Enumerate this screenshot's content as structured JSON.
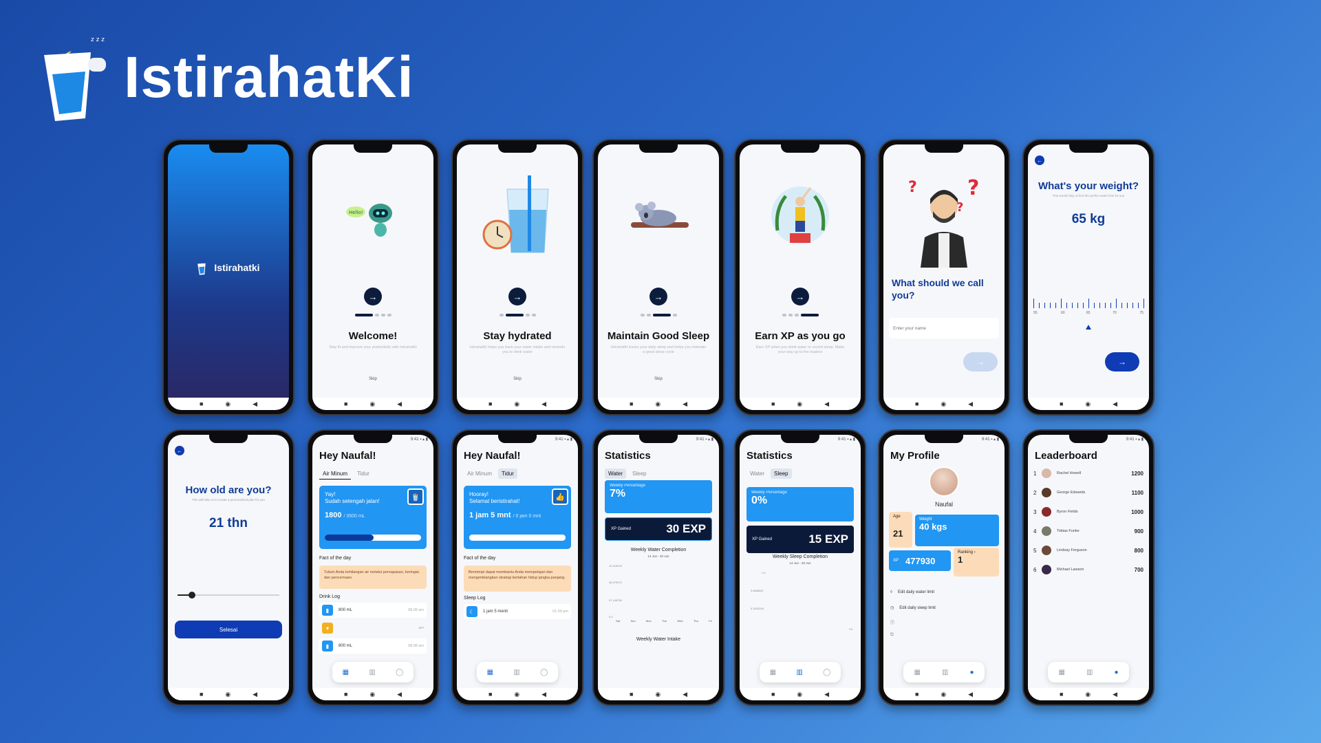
{
  "brand": {
    "name": "IstirahatKi",
    "sleep_glyph": "z z z"
  },
  "colors": {
    "primary": "#0f3cb4",
    "accent_blue": "#2196f3",
    "dark_navy": "#0c1a3a",
    "fact_bg": "#fcdcb8"
  },
  "splash": {
    "name": "Istirahatki"
  },
  "onboarding": [
    {
      "title": "Welcome!",
      "sub": "Stay fit and improve your productivity with IstirahatKi",
      "illus_icon": "robot-icon",
      "bubble": "Hello!",
      "skip": "Skip"
    },
    {
      "title": "Stay hydrated",
      "sub": "IstirahatKi helps you track your water intake and reminds you to drink water",
      "illus_icon": "water-glass-icon",
      "skip": "Skip"
    },
    {
      "title": "Maintain Good Sleep",
      "sub": "IstirahatKi tracks your daily sleep and helps you maintain a good sleep cycle",
      "illus_icon": "sleeping-koala-icon",
      "skip": "Skip"
    },
    {
      "title": "Earn XP as you go",
      "sub": "Earn XP when you drink water or record sleep. Make your way up to the leaders",
      "illus_icon": "trophy-person-icon"
    }
  ],
  "name_screen": {
    "title": "What should we call you?",
    "placeholder": "Enter your name"
  },
  "weight_screen": {
    "title": "What's your weight?",
    "sub": "This would help us find the perfect water limit for you",
    "value": "65 kg",
    "ticks": [
      "55",
      "60",
      "65",
      "70",
      "75"
    ]
  },
  "age_screen": {
    "title": "How old are you?",
    "sub": "This will help us to create a personalized plan for you",
    "value": "21 thn",
    "button": "Selesai"
  },
  "home_water": {
    "greeting": "Hey Naufal!",
    "tabs": [
      "Air Minum",
      "Tidur"
    ],
    "hero_l1": "Yay!",
    "hero_l2": "Sudah setengah jalan!",
    "hero_value": "1800",
    "hero_total": "/ 3500 mL",
    "progress": 0.51,
    "fact_label": "Fact of the day",
    "fact": "Tubuh Anda kehilangan air melalui pernapasan, keringat, dan pencernaan.",
    "log_label": "Drink Log",
    "logs": [
      {
        "amount": "800 mL",
        "time": "08.08 am"
      },
      {
        "amount": "",
        "time": "am"
      },
      {
        "amount": "800 mL",
        "time": "08.08 am"
      }
    ]
  },
  "home_sleep": {
    "greeting": "Hey Naufal!",
    "tabs": [
      "Air Minum",
      "Tidur"
    ],
    "hero_l1": "Hooray!",
    "hero_l2": "Selamat beristirahat!",
    "hero_value": "1 jam 5 mnt",
    "hero_total": "/ 0 jam 0 mnt",
    "progress": 1.0,
    "fact_label": "Fact of the day",
    "fact": "Bermimpi dapat membantu Anda mempelajari dan mengembangkan strategi bertahan hidup jangka panjang.",
    "log_label": "Sleep Log",
    "log": {
      "amount": "1 jam 5 menit",
      "time": "01.59 pm"
    }
  },
  "stats_water": {
    "title": "Statistics",
    "tabs": [
      "Water",
      "Sleep"
    ],
    "pct_label": "Weekly Percentage",
    "pct": "7%",
    "xp_label": "XP Gained",
    "xp": "30 EXP",
    "chart_title": "Weekly Water Completion",
    "chart_range": "14 Jun - 20 Jun",
    "y_ticks": [
      "10.419576",
      "36.075372",
      "57.148755",
      "0.0"
    ],
    "days": [
      "Sat",
      "Sun",
      "Mon",
      "Tue",
      "Wed",
      "Thu",
      "Fri"
    ],
    "chart2_title": "Weekly Water Intake"
  },
  "stats_sleep": {
    "title": "Statistics",
    "tabs": [
      "Water",
      "Sleep"
    ],
    "pct_label": "Weekly Percentage",
    "pct": "0%",
    "xp_label": "XP Gained",
    "xp": "15 EXP",
    "chart_title": "Weekly Sleep Completion",
    "chart_range": "14 Jun - 20 Jun",
    "y_ticks": [
      "1.0",
      "0.6666667",
      "0.3333333"
    ],
    "fri": "Fri"
  },
  "profile": {
    "title": "My Profile",
    "name": "Naufal",
    "age_label": "Age",
    "age": "21",
    "weight_label": "Weight",
    "weight": "40 kgs",
    "xp_label": "XP",
    "xp": "477930",
    "rank_label": "Ranking",
    "rank": "1",
    "menu": [
      "Edit daily water limit",
      "Edit daily sleep limit"
    ]
  },
  "leaderboard": {
    "title": "Leaderboard",
    "rows": [
      {
        "rank": "1",
        "name": "Rachel Howell",
        "score": "1200",
        "color": "#d8b8a8"
      },
      {
        "rank": "2",
        "name": "George Edwards",
        "score": "1100",
        "color": "#5a3a2a"
      },
      {
        "rank": "3",
        "name": "Byron Fields",
        "score": "1000",
        "color": "#8a2a2a"
      },
      {
        "rank": "4",
        "name": "Tobias Funke",
        "score": "900",
        "color": "#7a7a6a"
      },
      {
        "rank": "5",
        "name": "Lindsay Ferguson",
        "score": "800",
        "color": "#6a4a3a"
      },
      {
        "rank": "6",
        "name": "Michael Lawson",
        "score": "700",
        "color": "#3a2a4a"
      }
    ]
  },
  "status": "9:41 ▪ ▴ ▮"
}
